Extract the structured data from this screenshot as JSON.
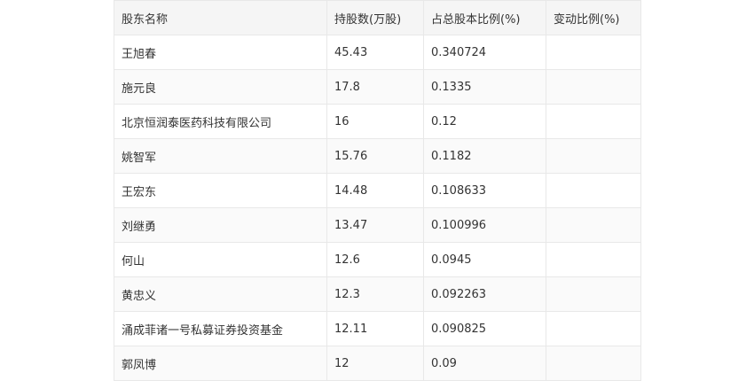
{
  "table": {
    "headers": [
      "股东名称",
      "持股数(万股)",
      "占总股本比例(%)",
      "变动比例(%)"
    ],
    "rows": [
      {
        "name": "王旭春",
        "shares": "45.43",
        "ratio": "0.340724",
        "change": ""
      },
      {
        "name": "施元良",
        "shares": "17.8",
        "ratio": "0.1335",
        "change": ""
      },
      {
        "name": "北京恒润泰医药科技有限公司",
        "shares": "16",
        "ratio": "0.12",
        "change": ""
      },
      {
        "name": "姚智军",
        "shares": "15.76",
        "ratio": "0.1182",
        "change": ""
      },
      {
        "name": "王宏东",
        "shares": "14.48",
        "ratio": "0.108633",
        "change": ""
      },
      {
        "name": "刘继勇",
        "shares": "13.47",
        "ratio": "0.100996",
        "change": ""
      },
      {
        "name": "何山",
        "shares": "12.6",
        "ratio": "0.0945",
        "change": ""
      },
      {
        "name": "黄忠义",
        "shares": "12.3",
        "ratio": "0.092263",
        "change": ""
      },
      {
        "name": "涌成菲诸一号私募证券投资基金",
        "shares": "12.11",
        "ratio": "0.090825",
        "change": ""
      },
      {
        "name": "郭凤博",
        "shares": "12",
        "ratio": "0.09",
        "change": ""
      }
    ]
  }
}
